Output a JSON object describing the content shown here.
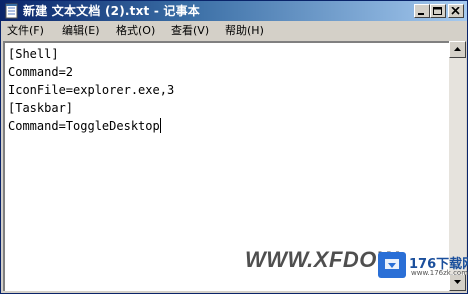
{
  "window": {
    "title": "新建 文本文档 (2).txt - 记事本"
  },
  "menu": [
    {
      "label": "文件(F)"
    },
    {
      "label": "编辑(E)"
    },
    {
      "label": "格式(O)"
    },
    {
      "label": "查看(V)"
    },
    {
      "label": "帮助(H)"
    }
  ],
  "editor": {
    "lines": [
      "[Shell]",
      "Command=2",
      "IconFile=explorer.exe,3",
      "[Taskbar]",
      "Command=ToggleDesktop"
    ]
  },
  "watermark": {
    "text": "WWW.XFDOW",
    "brand": "176下载网",
    "url": "www.176zk.com"
  },
  "colors": {
    "titlebar_start": "#0a246a",
    "titlebar_end": "#a6caf0",
    "chrome": "#d4d0c8"
  }
}
